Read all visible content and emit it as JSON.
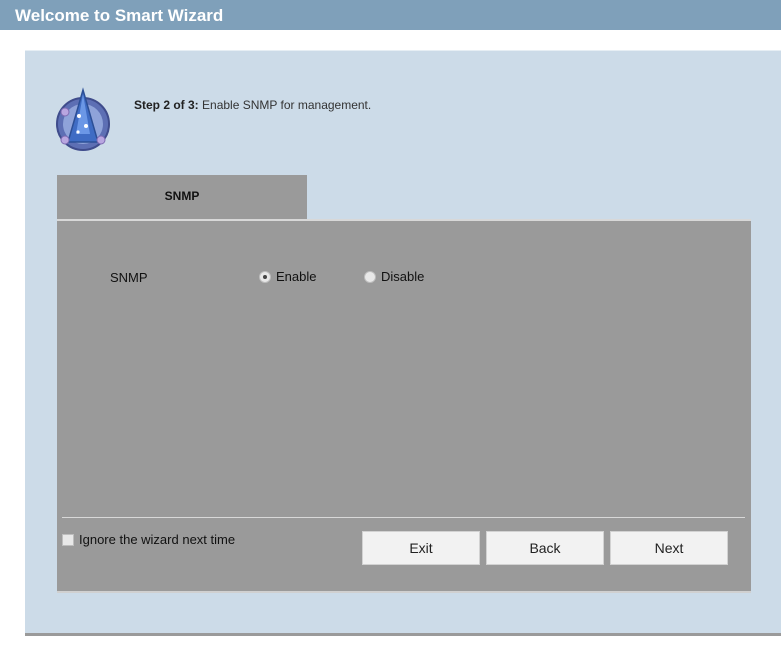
{
  "window": {
    "title": "Welcome to Smart Wizard"
  },
  "step": {
    "bold": "Step 2 of 3:",
    "text": " Enable SNMP for management."
  },
  "tabs": [
    {
      "label": "SNMP",
      "active": true
    }
  ],
  "snmp": {
    "label": "SNMP",
    "options": [
      {
        "label": "Enable",
        "selected": true
      },
      {
        "label": "Disable",
        "selected": false
      }
    ]
  },
  "footer": {
    "ignore_label": "Ignore the wizard next time",
    "ignore_checked": false,
    "exit_label": "Exit",
    "back_label": "Back",
    "next_label": "Next"
  },
  "icons": {
    "wizard": "wizard-hat-icon"
  }
}
